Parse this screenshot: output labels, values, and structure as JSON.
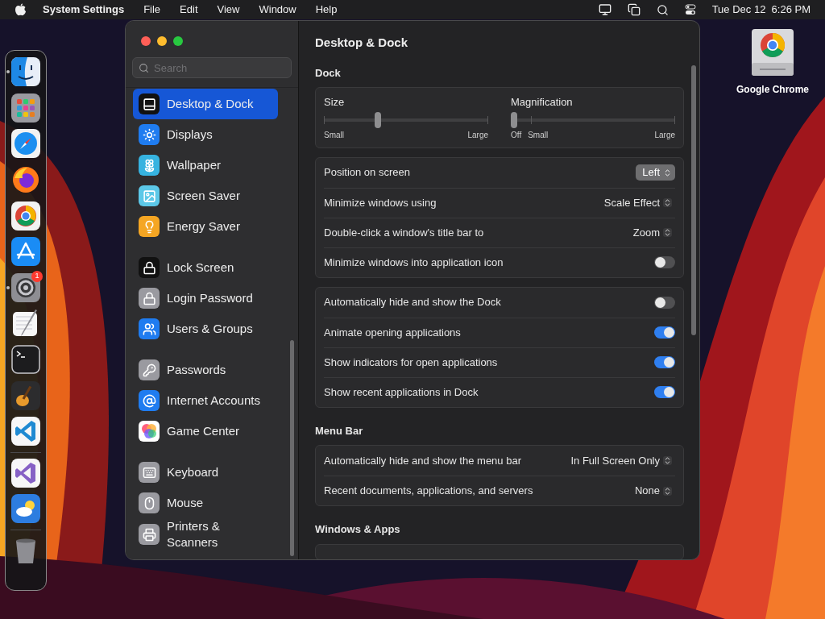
{
  "menu_bar": {
    "app_name": "System Settings",
    "menus": [
      "File",
      "Edit",
      "View",
      "Window",
      "Help"
    ],
    "clock": "Tue Dec 12  6:26 PM"
  },
  "dock": {
    "items": [
      {
        "running": true
      },
      {
        "running": false
      },
      {
        "running": false
      },
      {
        "running": false
      },
      {
        "running": false
      },
      {
        "running": false
      },
      {
        "running": true,
        "badge": "1"
      },
      {
        "running": false
      },
      {
        "running": false
      },
      {
        "running": false
      },
      {
        "running": false
      },
      {
        "kind": "separator"
      },
      {
        "running": false
      },
      {
        "running": false
      },
      {
        "kind": "separator"
      },
      {
        "running": false
      }
    ]
  },
  "desktop_icon": {
    "label": "Google Chrome"
  },
  "window": {
    "search": {
      "placeholder": "Search"
    },
    "sidebar": {
      "groups": [
        {
          "items": [
            {
              "label": "Desktop & Dock",
              "selected": true
            },
            {
              "label": "Displays",
              "selected": false
            },
            {
              "label": "Wallpaper",
              "selected": false
            },
            {
              "label": "Screen Saver",
              "selected": false
            },
            {
              "label": "Energy Saver",
              "selected": false
            }
          ]
        },
        {
          "items": [
            {
              "label": "Lock Screen",
              "selected": false
            },
            {
              "label": "Login Password",
              "selected": false
            },
            {
              "label": "Users & Groups",
              "selected": false
            }
          ]
        },
        {
          "items": [
            {
              "label": "Passwords",
              "selected": false
            },
            {
              "label": "Internet Accounts",
              "selected": false
            },
            {
              "label": "Game Center",
              "selected": false
            }
          ]
        },
        {
          "items": [
            {
              "label": "Keyboard",
              "selected": false
            },
            {
              "label": "Mouse",
              "selected": false
            },
            {
              "label": "Printers & Scanners",
              "selected": false
            }
          ]
        }
      ]
    },
    "title": "Desktop & Dock",
    "sections": [
      {
        "heading": "Dock",
        "cards": [
          {
            "kind": "sliders",
            "sliders": [
              {
                "label": "Size",
                "level": 0.32,
                "marks": [
                  "Small",
                  "Large"
                ]
              },
              {
                "label": "Magnification",
                "level": 0,
                "marks": [
                  "Off",
                  "Small",
                  "Large"
                ]
              }
            ]
          },
          {
            "kind": "rows",
            "rows": [
              {
                "kind": "select",
                "label": "Position on screen",
                "value": "Left",
                "pressed": true
              },
              {
                "kind": "select",
                "label": "Minimize windows using",
                "value": "Scale Effect",
                "pressed": false
              },
              {
                "kind": "select",
                "label": "Double-click a window's title bar to",
                "value": "Zoom",
                "pressed": false
              },
              {
                "kind": "toggle",
                "label": "Minimize windows into application icon",
                "on": false
              }
            ]
          },
          {
            "kind": "rows",
            "rows": [
              {
                "kind": "toggle",
                "label": "Automatically hide and show the Dock",
                "on": false
              },
              {
                "kind": "toggle",
                "label": "Animate opening applications",
                "on": true
              },
              {
                "kind": "toggle",
                "label": "Show indicators for open applications",
                "on": true
              },
              {
                "kind": "toggle",
                "label": "Show recent applications in Dock",
                "on": true
              }
            ]
          }
        ]
      },
      {
        "heading": "Menu Bar",
        "cards": [
          {
            "kind": "rows",
            "rows": [
              {
                "kind": "select",
                "label": "Automatically hide and show the menu bar",
                "value": "In Full Screen Only",
                "pressed": false
              },
              {
                "kind": "select",
                "label": "Recent documents, applications, and servers",
                "value": "None",
                "pressed": false
              }
            ]
          }
        ]
      },
      {
        "heading": "Windows & Apps",
        "cards": [
          {
            "kind": "rows"
          }
        ]
      }
    ]
  }
}
